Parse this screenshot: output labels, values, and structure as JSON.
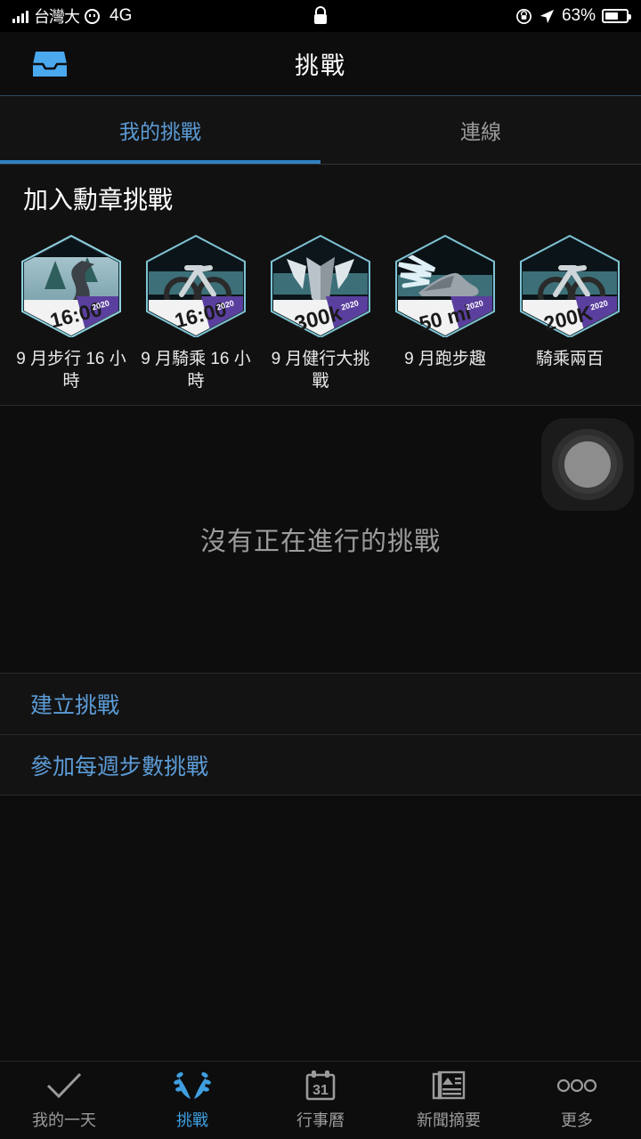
{
  "status_bar": {
    "carrier": "台灣大",
    "network": "4G",
    "lock_icon": "lock-icon",
    "rotation_icon": "rotation-lock-icon",
    "location_icon": "location-arrow-icon",
    "battery_percent": "63%",
    "battery_level": 63
  },
  "header": {
    "title": "挑戰",
    "inbox_icon": "inbox-tray-icon",
    "accent": "#3f9fe0"
  },
  "tabs": [
    {
      "label": "我的挑戰",
      "active": true
    },
    {
      "label": "連線",
      "active": false
    }
  ],
  "badge_section": {
    "title": "加入勳章挑戰",
    "badges": [
      {
        "caption": "9 月步行 16 小時",
        "value": "16:00",
        "year": "2020",
        "art": "trail-road-icon"
      },
      {
        "caption": "9 月騎乘 16 小時",
        "value": "16:00",
        "year": "2020",
        "art": "bicycle-icon"
      },
      {
        "caption": "9 月健行大挑戰",
        "value": "300k",
        "year": "2020",
        "art": "wings-chevron-icon"
      },
      {
        "caption": "9 月跑步趣",
        "value": "50 mi",
        "year": "2020",
        "art": "winged-shoe-icon"
      },
      {
        "caption": "騎乘兩百",
        "value": "200K",
        "year": "2020",
        "art": "bicycle-icon"
      }
    ]
  },
  "empty_state": {
    "message": "沒有正在進行的挑戰",
    "assistive_button_icon": "assistive-touch-icon"
  },
  "actions": [
    {
      "label": "建立挑戰"
    },
    {
      "label": "參加每週步數挑戰"
    }
  ],
  "bottom_nav": [
    {
      "label": "我的一天",
      "icon": "check-icon",
      "active": false
    },
    {
      "label": "挑戰",
      "icon": "laurel-wreath-icon",
      "active": true
    },
    {
      "label": "行事曆",
      "icon": "calendar-icon",
      "active": false
    },
    {
      "label": "新聞摘要",
      "icon": "newspaper-icon",
      "active": false
    },
    {
      "label": "更多",
      "icon": "ellipsis-icon",
      "active": false
    }
  ]
}
